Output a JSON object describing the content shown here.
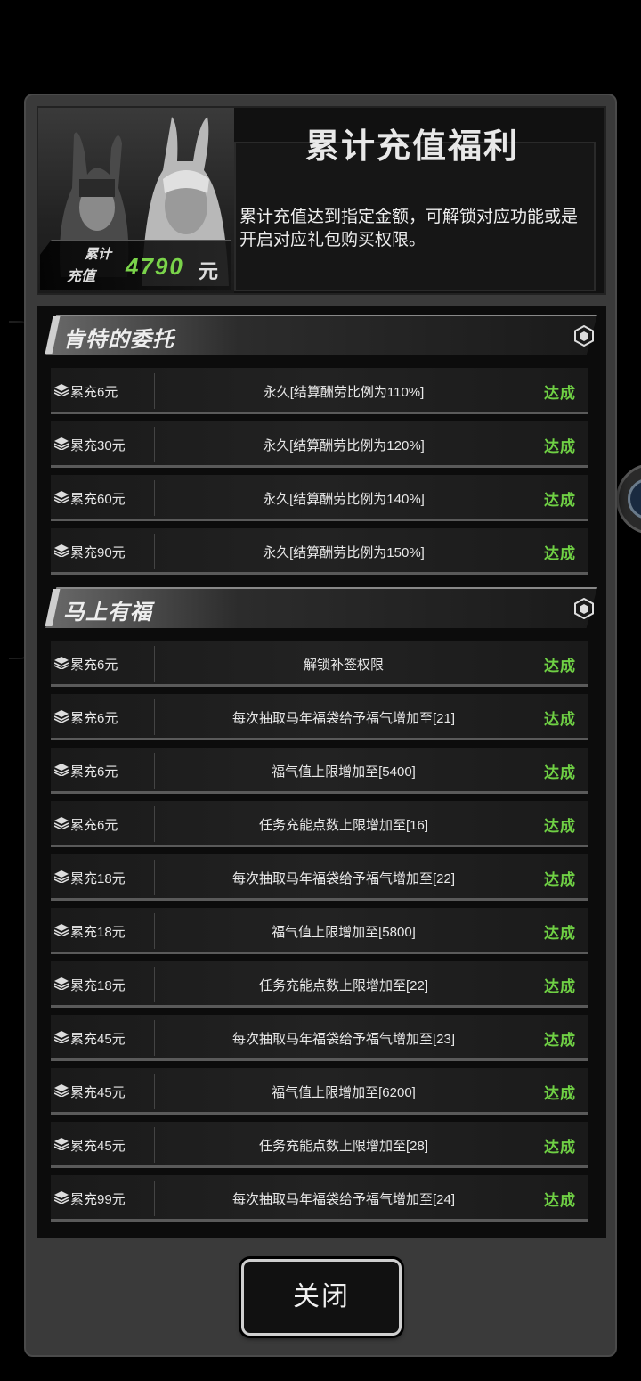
{
  "header": {
    "title": "累计充值福利",
    "description": "累计充值达到指定金额，可解锁对应功能或是开启对应礼包购买权限。",
    "badge_line1": "累计",
    "badge_line2": "充值",
    "amount": "4790",
    "unit": "元"
  },
  "sections": [
    {
      "title": "肯特的委托",
      "icon": "hexagon-icon",
      "rows": [
        {
          "condition": "累充6元",
          "reward": "永久[结算酬劳比例为110%]",
          "status": "达成"
        },
        {
          "condition": "累充30元",
          "reward": "永久[结算酬劳比例为120%]",
          "status": "达成"
        },
        {
          "condition": "累充60元",
          "reward": "永久[结算酬劳比例为140%]",
          "status": "达成"
        },
        {
          "condition": "累充90元",
          "reward": "永久[结算酬劳比例为150%]",
          "status": "达成"
        }
      ]
    },
    {
      "title": "马上有福",
      "icon": "hexagon-icon",
      "rows": [
        {
          "condition": "累充6元",
          "reward": "解锁补签权限",
          "status": "达成"
        },
        {
          "condition": "累充6元",
          "reward": "每次抽取马年福袋给予福气增加至[21]",
          "status": "达成"
        },
        {
          "condition": "累充6元",
          "reward": "福气值上限增加至[5400]",
          "status": "达成"
        },
        {
          "condition": "累充6元",
          "reward": "任务充能点数上限增加至[16]",
          "status": "达成"
        },
        {
          "condition": "累充18元",
          "reward": "每次抽取马年福袋给予福气增加至[22]",
          "status": "达成"
        },
        {
          "condition": "累充18元",
          "reward": "福气值上限增加至[5800]",
          "status": "达成"
        },
        {
          "condition": "累充18元",
          "reward": "任务充能点数上限增加至[22]",
          "status": "达成"
        },
        {
          "condition": "累充45元",
          "reward": "每次抽取马年福袋给予福气增加至[23]",
          "status": "达成"
        },
        {
          "condition": "累充45元",
          "reward": "福气值上限增加至[6200]",
          "status": "达成"
        },
        {
          "condition": "累充45元",
          "reward": "任务充能点数上限增加至[28]",
          "status": "达成"
        },
        {
          "condition": "累充99元",
          "reward": "每次抽取马年福袋给予福气增加至[24]",
          "status": "达成"
        }
      ]
    }
  ],
  "close_label": "关闭",
  "colors": {
    "accent_green": "#6fd044",
    "amount_green": "#7ad34a",
    "panel_bg": "#3a3a3a"
  }
}
